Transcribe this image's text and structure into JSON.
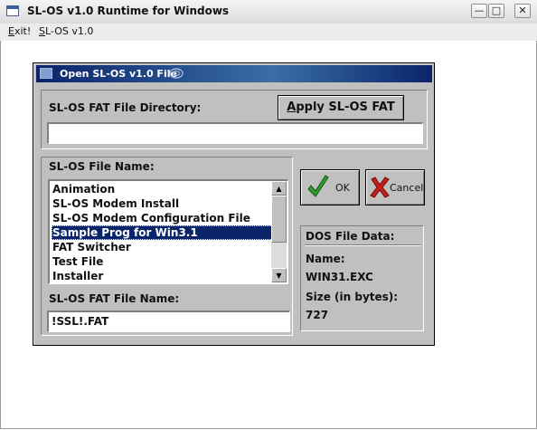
{
  "window": {
    "title": "SL-OS v1.0 Runtime for Windows"
  },
  "menubar": {
    "items": [
      {
        "label": "Exit!",
        "accel": "E",
        "rest": "xit!"
      },
      {
        "label": "SL-OS v1.0",
        "accel": "S",
        "rest": "L-OS v1.0"
      }
    ]
  },
  "dialog": {
    "title": "Open SL-OS v1.0 File",
    "fat_dir_label": "SL-OS FAT File Directory:",
    "apply_button": {
      "accel": "A",
      "rest": "pply SL-OS FAT"
    },
    "fat_dir_value": "",
    "file_name_label": "SL-OS File Name:",
    "files": [
      "Animation",
      "SL-OS Modem Install",
      "SL-OS Modem Configuration File",
      "Sample Prog for Win3.1",
      "FAT Switcher",
      "Test File",
      "Installer"
    ],
    "selected_file": "Sample Prog for Win3.1",
    "fat_name_label": "SL-OS FAT File Name:",
    "fat_name_value": "!SSL!.FAT",
    "ok_label": "OK",
    "cancel_label": "Cancel",
    "dos": {
      "header": "DOS File Data:",
      "name_label": "Name:",
      "name_value": "WIN31.EXC",
      "size_label": "Size (in bytes):",
      "size_value": "727"
    }
  },
  "colors": {
    "selection": "#0a246a",
    "dialog_bg": "#c0c0c0",
    "ok_check": "#2e9e2e",
    "cancel_x": "#c81e1e"
  },
  "icons": [
    "app-icon",
    "minimize-icon",
    "maximize-icon",
    "close-icon",
    "checkmark-icon",
    "x-cancel-icon",
    "scroll-up-arrow-icon",
    "scroll-down-arrow-icon"
  ]
}
